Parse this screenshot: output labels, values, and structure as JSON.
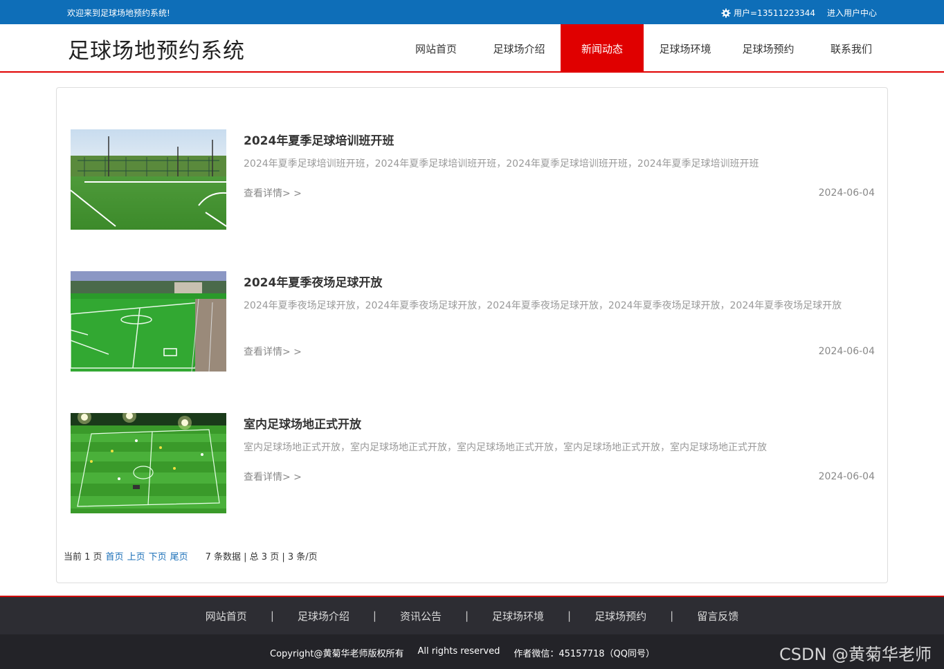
{
  "topbar": {
    "welcome": "欢迎来到足球场地预约系统!",
    "user": "用户=13511223344",
    "user_center": "进入用户中心"
  },
  "header": {
    "site_title": "足球场地预约系统"
  },
  "nav": [
    {
      "label": "网站首页"
    },
    {
      "label": "足球场介绍"
    },
    {
      "label": "新闻动态"
    },
    {
      "label": "足球场环境"
    },
    {
      "label": "足球场预约"
    },
    {
      "label": "联系我们"
    }
  ],
  "news": [
    {
      "title": "2024年夏季足球培训班开班",
      "summary": "2024年夏季足球培训班开班，2024年夏季足球培训班开班，2024年夏季足球培训班开班，2024年夏季足球培训班开班",
      "more": "查看详情> >",
      "date": "2024-06-04"
    },
    {
      "title": "2024年夏季夜场足球开放",
      "summary": "2024年夏季夜场足球开放，2024年夏季夜场足球开放，2024年夏季夜场足球开放，2024年夏季夜场足球开放，2024年夏季夜场足球开放",
      "more": "查看详情> >",
      "date": "2024-06-04"
    },
    {
      "title": "室内足球场地正式开放",
      "summary": "室内足球场地正式开放，室内足球场地正式开放，室内足球场地正式开放，室内足球场地正式开放，室内足球场地正式开放",
      "more": "查看详情> >",
      "date": "2024-06-04"
    }
  ],
  "pager": {
    "current": "当前 1 页",
    "first": "首页",
    "prev": "上页",
    "next": "下页",
    "last": "尾页",
    "stats": "7 条数据 | 总 3 页 | 3 条/页"
  },
  "footer_nav": [
    {
      "label": "网站首页"
    },
    {
      "label": "足球场介绍"
    },
    {
      "label": "资讯公告"
    },
    {
      "label": "足球场环境"
    },
    {
      "label": "足球场预约"
    },
    {
      "label": "留言反馈"
    }
  ],
  "footer": {
    "copyright": "Copyright@黄菊华老师版权所有",
    "rights": "All rights reserved",
    "wechat": "作者微信：45157718（QQ同号）"
  },
  "watermark": "CSDN @黄菊华老师",
  "colors": {
    "topbar": "#0e6eb8",
    "accent": "#e00000",
    "footer": "#2d2d33"
  }
}
